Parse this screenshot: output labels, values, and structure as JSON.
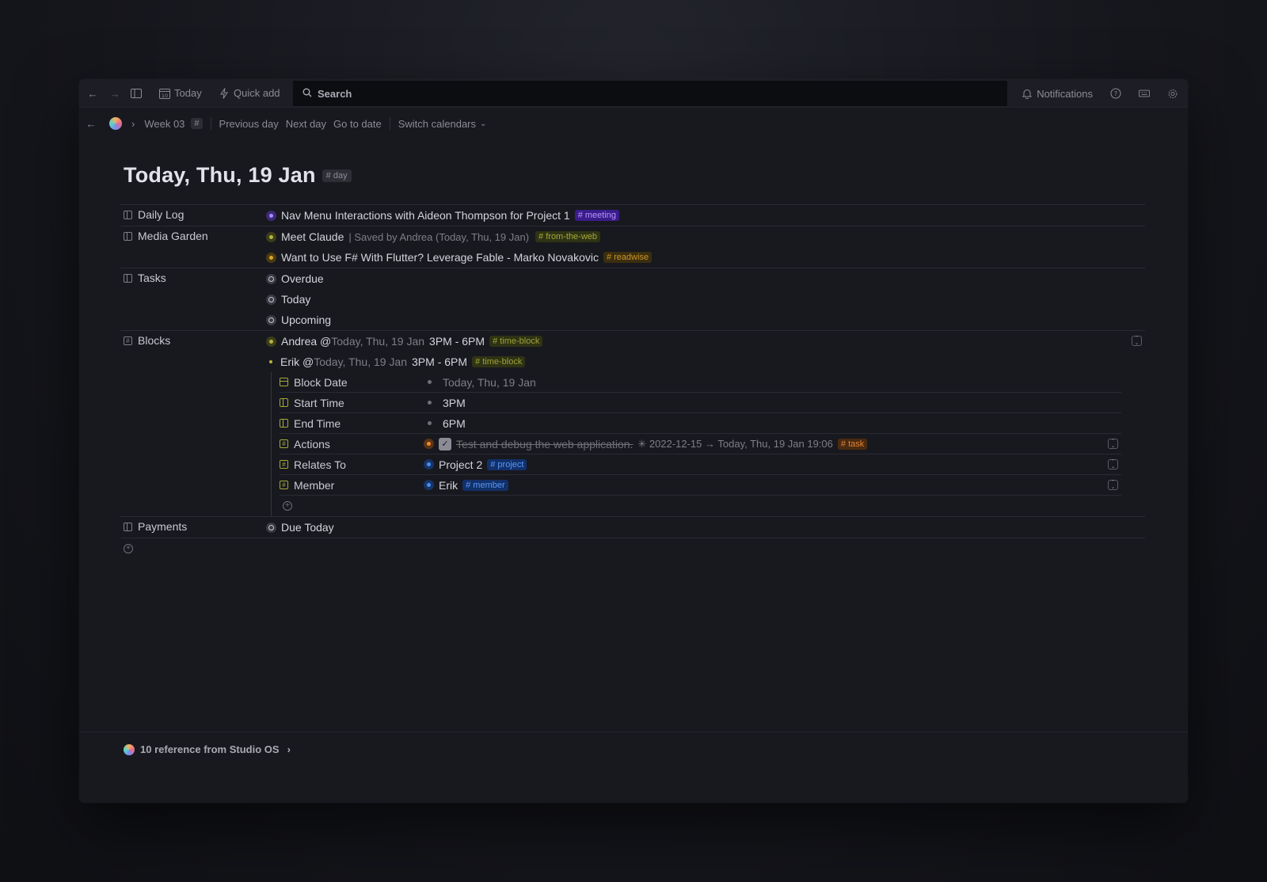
{
  "topbar": {
    "today_label": "Today",
    "today_date": "10",
    "quick_add_label": "Quick add",
    "search_label": "Search",
    "notifications_label": "Notifications"
  },
  "breadcrumb": {
    "week_label": "Week 03",
    "hash": "#",
    "previous_day": "Previous day",
    "next_day": "Next day",
    "go_to_date": "Go to date",
    "switch_calendars": "Switch calendars"
  },
  "page": {
    "title": "Today, Thu, 19 Jan",
    "tag": "# day"
  },
  "sections": {
    "daily_log": {
      "label": "Daily Log",
      "items": [
        {
          "text": "Nav Menu Interactions with Aideon Thompson for Project 1",
          "tag": "# meeting"
        }
      ]
    },
    "media_garden": {
      "label": "Media Garden",
      "items": [
        {
          "text": "Meet Claude",
          "meta": "| Saved by Andrea (Today, Thu, 19 Jan)",
          "tag": "# from-the-web"
        },
        {
          "text": "Want to Use F# With Flutter? Leverage Fable - Marko Novakovic",
          "tag": "# readwise"
        }
      ]
    },
    "tasks": {
      "label": "Tasks",
      "items": [
        "Overdue",
        "Today",
        "Upcoming"
      ]
    },
    "blocks": {
      "label": "Blocks",
      "items": [
        {
          "name": "Andrea @",
          "date": "Today, Thu, 19 Jan",
          "time": "3PM - 6PM",
          "tag": "# time-block"
        },
        {
          "name": "Erik @",
          "date": "Today, Thu, 19 Jan",
          "time": "3PM - 6PM",
          "tag": "# time-block"
        }
      ],
      "properties": {
        "block_date": {
          "label": "Block Date",
          "value": "Today, Thu, 19 Jan"
        },
        "start_time": {
          "label": "Start Time",
          "value": "3PM"
        },
        "end_time": {
          "label": "End Time",
          "value": "6PM"
        },
        "actions": {
          "label": "Actions",
          "value": "Test and debug the web application.",
          "meta": "✳ 2022-12-15 → Today, Thu, 19 Jan 19:06",
          "tag": "# task"
        },
        "relates_to": {
          "label": "Relates To",
          "value": "Project 2",
          "tag": "# project"
        },
        "member": {
          "label": "Member",
          "value": "Erik",
          "tag": "# member"
        }
      }
    },
    "payments": {
      "label": "Payments",
      "items": [
        "Due Today"
      ]
    }
  },
  "footer": {
    "reference_text": "10 reference from Studio OS"
  }
}
